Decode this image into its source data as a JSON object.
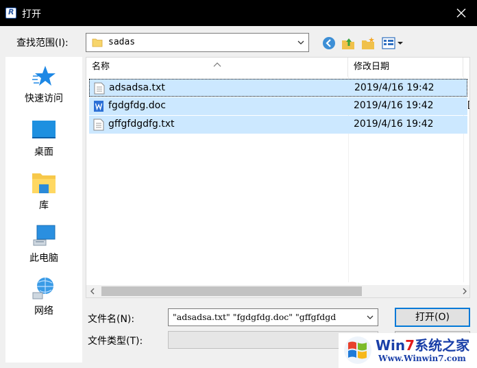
{
  "window": {
    "title": "打开",
    "close_icon": "close-icon"
  },
  "toolbar": {
    "lookin_label": "查找范围(I):",
    "lookin_value": "sadas",
    "icons": [
      "back-icon",
      "up-folder-icon",
      "new-folder-icon",
      "view-menu-icon"
    ]
  },
  "places": [
    {
      "label": "快速访问",
      "icon": "star-icon"
    },
    {
      "label": "桌面",
      "icon": "desktop-icon"
    },
    {
      "label": "库",
      "icon": "library-icon"
    },
    {
      "label": "此电脑",
      "icon": "computer-icon"
    },
    {
      "label": "网络",
      "icon": "network-icon"
    }
  ],
  "filelist": {
    "columns": [
      "名称",
      "修改日期",
      "..."
    ],
    "rows": [
      {
        "name": "adsadsa.txt",
        "date": "2019/4/16 19:42",
        "extra": ""
      },
      {
        "name": "fgdgfdg.doc",
        "date": "2019/4/16 19:42",
        "extra": "["
      },
      {
        "name": "gffgfdgdfg.txt",
        "date": "2019/4/16 19:42",
        "extra": ""
      }
    ]
  },
  "filename": {
    "label": "文件名(N):",
    "value": "\"adsadsa.txt\" \"fgdgfdg.doc\" \"gffgfdgd"
  },
  "filetype": {
    "label": "文件类型(T):",
    "value": ""
  },
  "buttons": {
    "open_label": "打开(O)"
  },
  "watermark": {
    "line1_a": "Win",
    "line1_b": "7",
    "line1_c": "系统之家",
    "line2": "Www.Winwin7.com"
  },
  "colors": {
    "selection": "#cce8ff",
    "accent": "#0078d7",
    "titlebar": "#000000"
  }
}
